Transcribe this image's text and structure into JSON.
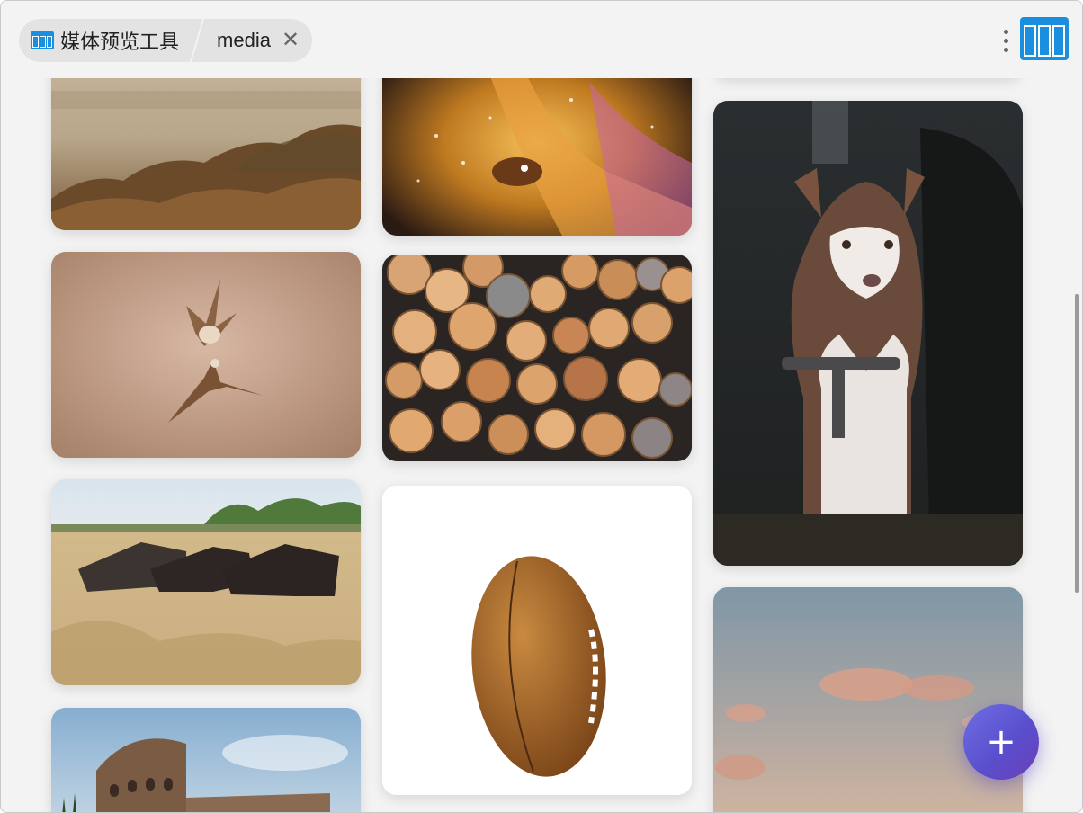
{
  "titlebar": {
    "app_label": "媒体预览工具",
    "folder_label": "media",
    "close_glyph": "✕",
    "app_icon": "window-panels-icon",
    "view_icon": "layout-columns-icon",
    "menu_icon": "more-vertical-icon"
  },
  "fab": {
    "label": "+"
  },
  "colors": {
    "accent": "#1a8fe0",
    "fab_start": "#6e6fe0",
    "fab_end": "#6a3fb5",
    "background": "#f3f3f3"
  },
  "gallery": {
    "items": [
      "grass-photo",
      "fantasy-illustration",
      "birds-photo",
      "logs-photo",
      "wildebeest-photo",
      "rugby-ball-photo",
      "colosseum-photo",
      "husky-puppy-photo",
      "sunset-sky-photo"
    ]
  }
}
